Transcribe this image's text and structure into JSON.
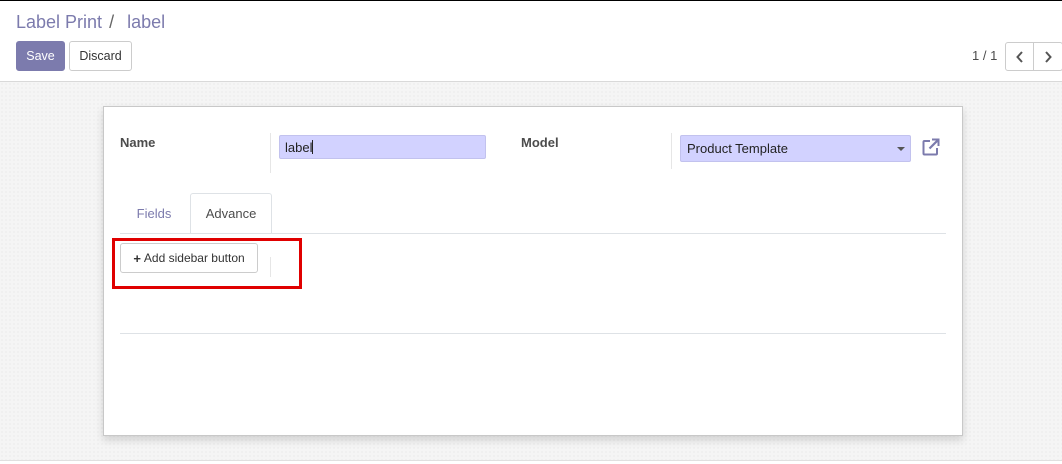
{
  "breadcrumb": {
    "parent": "Label Print",
    "separator": "/",
    "current": "label"
  },
  "toolbar": {
    "save_label": "Save",
    "discard_label": "Discard"
  },
  "pager": {
    "value": "1 / 1",
    "prev_icon": "chevron-left-icon",
    "next_icon": "chevron-right-icon"
  },
  "form": {
    "name_label": "Name",
    "name_value": "label",
    "model_label": "Model",
    "model_value": "Product Template",
    "external_link_icon": "external-link-icon"
  },
  "tabs": [
    {
      "label": "Fields",
      "active": false
    },
    {
      "label": "Advance",
      "active": true
    }
  ],
  "advance_tab": {
    "add_sidebar_button_label": "Add sidebar button"
  },
  "colors": {
    "brand": "#7c7bad",
    "input_bg": "#d2d2ff",
    "highlight": "#e00000"
  }
}
